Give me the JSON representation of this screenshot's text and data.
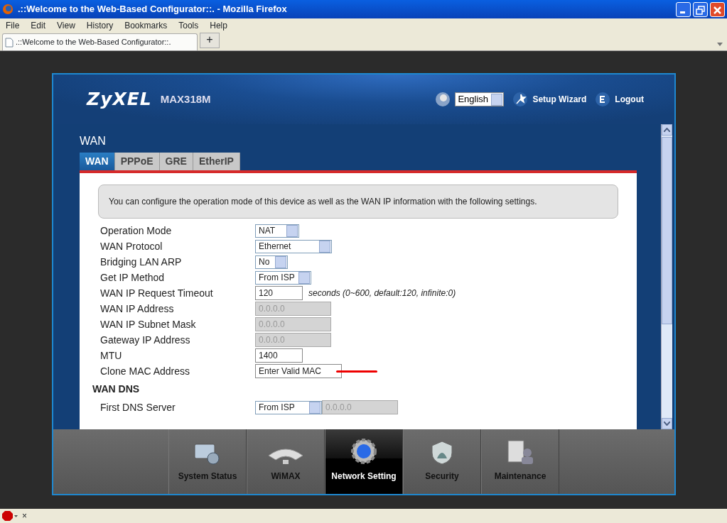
{
  "browser": {
    "title": ".::Welcome to the Web-Based Configurator::. - Mozilla Firefox",
    "menu": [
      "File",
      "Edit",
      "View",
      "History",
      "Bookmarks",
      "Tools",
      "Help"
    ],
    "tabs": [
      {
        "label": ".::Welcome to the Web-Based Configurator::.",
        "selected": true
      }
    ],
    "new_tab": "+",
    "status_close": "×"
  },
  "router": {
    "logo": "ZyXEL",
    "model": "MAX318M",
    "language": "English",
    "links": [
      {
        "label": "Setup Wizard",
        "kind": "wizard"
      },
      {
        "label": "Logout",
        "kind": "logout"
      }
    ],
    "page_title": "WAN",
    "tabs": [
      {
        "label": "WAN",
        "selected": true
      },
      {
        "label": "PPPoE",
        "selected": false
      },
      {
        "label": "GRE",
        "selected": false
      },
      {
        "label": "EtherIP",
        "selected": false
      }
    ],
    "intro": "You can configure the operation mode of this device as well as the WAN IP information with the following settings.",
    "fields": [
      {
        "label": "Operation Mode",
        "kind": "select",
        "value": "NAT"
      },
      {
        "label": "WAN Protocol",
        "kind": "select",
        "value": "Ethernet"
      },
      {
        "label": "Bridging LAN ARP",
        "kind": "select",
        "value": "No"
      },
      {
        "label": "Get IP Method",
        "kind": "select",
        "value": "From ISP"
      },
      {
        "label": "WAN IP Request Timeout",
        "kind": "text",
        "value": "120",
        "hint": "seconds (0~600, default:120, infinite:0)"
      },
      {
        "label": "WAN IP Address",
        "kind": "disabled",
        "value": "0.0.0.0"
      },
      {
        "label": "WAN IP Subnet Mask",
        "kind": "disabled",
        "value": "0.0.0.0"
      },
      {
        "label": "Gateway IP Address",
        "kind": "disabled",
        "value": "0.0.0.0"
      },
      {
        "label": "MTU",
        "kind": "text",
        "value": "1400"
      },
      {
        "label": "Clone MAC Address",
        "kind": "wide",
        "value": "Enter Valid MAC"
      }
    ],
    "dns_title": "WAN DNS",
    "dns_fields": [
      {
        "label": "First DNS Server",
        "kind": "select_disabled",
        "value": "From ISP",
        "value2": "0.0.0.0"
      }
    ],
    "nav": [
      {
        "label": "System Status",
        "kind": "status",
        "selected": false
      },
      {
        "label": "WiMAX",
        "kind": "wimax",
        "selected": false
      },
      {
        "label": "Network Setting",
        "kind": "network",
        "selected": true
      },
      {
        "label": "Security",
        "kind": "security",
        "selected": false
      },
      {
        "label": "Maintenance",
        "kind": "maintenance",
        "selected": false
      }
    ]
  }
}
